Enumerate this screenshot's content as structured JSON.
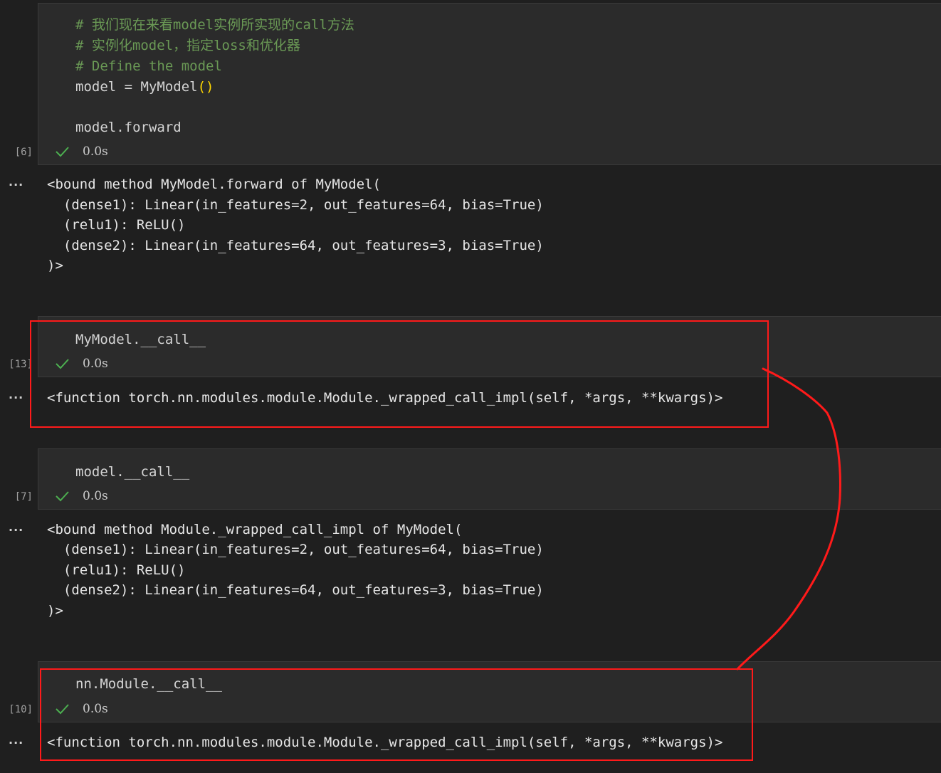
{
  "cells": [
    {
      "exec_count": "[6]",
      "time": "0.0s",
      "input_lines": [
        "# 我们现在来看model实例所实现的call方法",
        "# 实例化model，指定loss和优化器",
        "# Define the model",
        "model = MyModel",
        "()",
        "",
        "model.forward"
      ],
      "output_lines": [
        "<bound method MyModel.forward of MyModel(",
        "  (dense1): Linear(in_features=2, out_features=64, bias=True)",
        "  (relu1): ReLU()",
        "  (dense2): Linear(in_features=64, out_features=3, bias=True)",
        ")>"
      ]
    },
    {
      "exec_count": "[13]",
      "time": "0.0s",
      "input_lines": [
        "MyModel.__call__"
      ],
      "output_lines": [
        "<function torch.nn.modules.module.Module._wrapped_call_impl(self, *args, **kwargs)>"
      ]
    },
    {
      "exec_count": "[7]",
      "time": "0.0s",
      "input_lines": [
        "model.__call__"
      ],
      "output_lines": [
        "<bound method Module._wrapped_call_impl of MyModel(",
        "  (dense1): Linear(in_features=2, out_features=64, bias=True)",
        "  (relu1): ReLU()",
        "  (dense2): Linear(in_features=64, out_features=3, bias=True)",
        ")>"
      ]
    },
    {
      "exec_count": "[10]",
      "time": "0.0s",
      "input_lines": [
        "nn.Module.__call__"
      ],
      "output_lines": [
        "<function torch.nn.modules.module.Module._wrapped_call_impl(self, *args, **kwargs)>"
      ]
    }
  ],
  "output_menu_label": "...",
  "colors": {
    "comment": "#6a9955",
    "annotation": "#ff1a1a",
    "success_check": "#4caf50"
  }
}
